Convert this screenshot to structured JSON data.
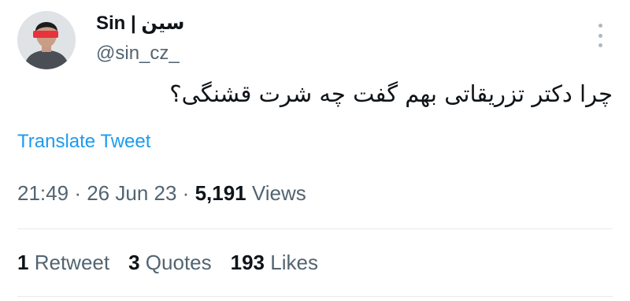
{
  "author": {
    "display_name": "Sin | سین",
    "handle": "@sin_cz_"
  },
  "tweet": {
    "text": "چرا دکتر تزریقاتی بهم گفت چه شرت قشنگی؟",
    "translate_label": "Translate Tweet"
  },
  "meta": {
    "time": "21:49",
    "separator": "·",
    "date": "26 Jun 23",
    "views_count": "5,191",
    "views_label": "Views"
  },
  "stats": {
    "retweets_count": "1",
    "retweets_label": "Retweet",
    "quotes_count": "3",
    "quotes_label": "Quotes",
    "likes_count": "193",
    "likes_label": "Likes"
  },
  "icons": {
    "more": "more-vertical-icon",
    "avatar": "profile-photo"
  },
  "colors": {
    "link": "#1d9bf0",
    "secondary_text": "#536471",
    "primary_text": "#0f1419",
    "redaction": "#e8323c"
  }
}
